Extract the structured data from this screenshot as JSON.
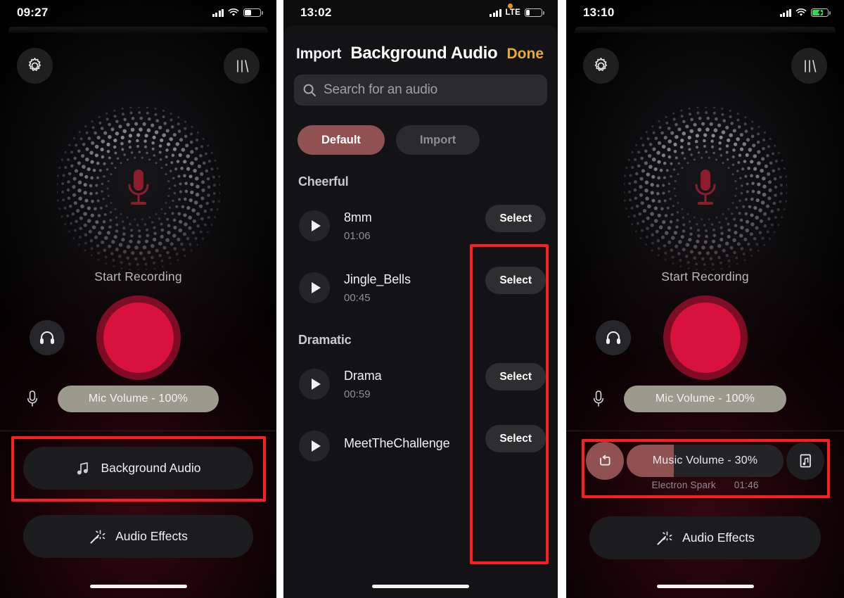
{
  "panel1": {
    "status": {
      "time": "09:27",
      "carrier": "",
      "battery_level": 45,
      "charging": false,
      "rec_dot": false
    },
    "icons": {
      "settings": "gear-icon",
      "bars": "equalizer-bars-icon",
      "mic": "microphone-icon",
      "headphones": "headphones-icon"
    },
    "start_label": "Start Recording",
    "mic_volume": "Mic Volume -  100%",
    "background_audio_label": "Background Audio",
    "audio_effects_label": "Audio Effects",
    "highlight_color": "#fc1f1f",
    "record_color": "#d8123e"
  },
  "panel2": {
    "status": {
      "time": "13:02",
      "carrier": "LTE",
      "battery_level": 22,
      "charging": false,
      "rec_dot": true
    },
    "header": {
      "left_action": "Import",
      "title": "Background Audio",
      "right_action": "Done"
    },
    "search": {
      "placeholder": "Search for an audio",
      "value": "",
      "icon": "search-icon"
    },
    "segments": [
      {
        "label": "Default",
        "selected": true
      },
      {
        "label": "Import",
        "selected": false
      }
    ],
    "sections": [
      {
        "title": "Cheerful",
        "tracks": [
          {
            "name": "8mm",
            "duration": "01:06",
            "action": "Select"
          },
          {
            "name": "Jingle_Bells",
            "duration": "00:45",
            "action": "Select"
          }
        ]
      },
      {
        "title": "Dramatic",
        "tracks": [
          {
            "name": "Drama",
            "duration": "00:59",
            "action": "Select"
          },
          {
            "name": "MeetTheChallenge",
            "duration": "",
            "action": "Select"
          }
        ]
      }
    ],
    "accent_color": "#8f5152"
  },
  "panel3": {
    "status": {
      "time": "13:10",
      "carrier": "",
      "battery_level": 62,
      "charging": true,
      "rec_dot": false
    },
    "start_label": "Start Recording",
    "mic_volume": "Mic Volume -  100%",
    "music": {
      "label": "Music Volume -  30%",
      "percent": 30,
      "track_name": "Electron Spark",
      "track_duration": "01:46",
      "loop_icon": "loop-repeat-icon",
      "note_icon": "music-note-card-icon"
    },
    "audio_effects_label": "Audio Effects"
  }
}
